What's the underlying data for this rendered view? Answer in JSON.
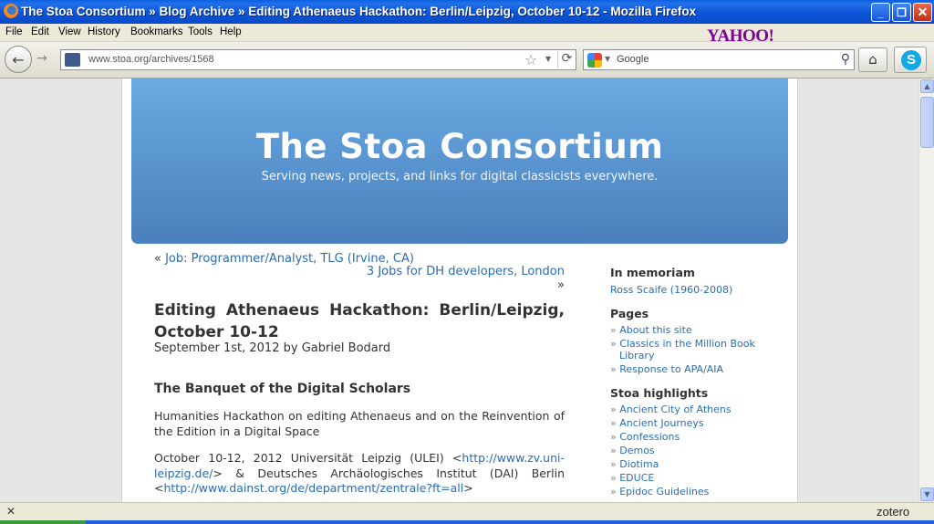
{
  "window": {
    "title": "The Stoa Consortium » Blog Archive » Editing Athenaeus Hackathon: Berlin/Leipzig, October 10-12 - Mozilla Firefox",
    "min_glyph": "_",
    "max_glyph": "❐",
    "close_glyph": "✕"
  },
  "menu": {
    "file": "File",
    "edit": "Edit",
    "view": "View",
    "history": "History",
    "bookmarks": "Bookmarks",
    "tools": "Tools",
    "help": "Help"
  },
  "yahoo_logo": "YAHOO!",
  "nav": {
    "url": "www.stoa.org/archives/1568",
    "search_placeholder": "Google",
    "back_glyph": "←",
    "forward_glyph": "→",
    "star_glyph": "☆",
    "reload_glyph": "⟳",
    "home_glyph": "⌂",
    "skype_glyph": "S",
    "search_glyph": "⚲"
  },
  "header": {
    "title": "The Stoa Consortium",
    "subtitle": "Serving news, projects, and links for digital classicists everywhere."
  },
  "postnav": {
    "prev_prefix": "« ",
    "prev_label": "Job: Programmer/Analyst, TLG (Irvine, CA)",
    "next_label": "3 Jobs for DH developers, London",
    "next_suffix": " »"
  },
  "post": {
    "title_line1_words": [
      "Editing",
      "Athenaeus",
      "Hackathon:",
      "Berlin/Leipzig,"
    ],
    "title_line2": "October 10-12",
    "meta": "September 1st, 2012 by Gabriel Bodard",
    "heading": "The Banquet of the Digital Scholars",
    "p1": "Humanities Hackathon on editing Athenaeus and on the Reinvention of the Edition in a Digital Space",
    "p2_text1": "October 10-12, 2012 Universität Leipzig (ULEI) <",
    "p2_link1": "http://www.zv.uni-leipzig.de/",
    "p2_text2": "> & Deutsches Archäologisches Institut (DAI) Berlin <",
    "p2_link2": "http://www.dainst.org/de/department/zentrale?ft=all",
    "p2_text3": ">"
  },
  "sidebar": {
    "memoriam_title": "In memoriam",
    "memoriam_link": "Ross Scaife (1960-2008)",
    "pages_title": "Pages",
    "pages": [
      "About this site",
      "Classics in the Million Book Library",
      "Response to APA/AIA"
    ],
    "highlights_title": "Stoa highlights",
    "highlights": [
      "Ancient City of Athens",
      "Ancient Journeys",
      "Confessions",
      "Demos",
      "Diotima",
      "EDUCE",
      "Epidoc Guidelines"
    ],
    "bullet": "» "
  },
  "scroll": {
    "up_glyph": "▲",
    "down_glyph": "▼"
  },
  "status": {
    "close_glyph": "✕",
    "zotero": "zotero"
  }
}
